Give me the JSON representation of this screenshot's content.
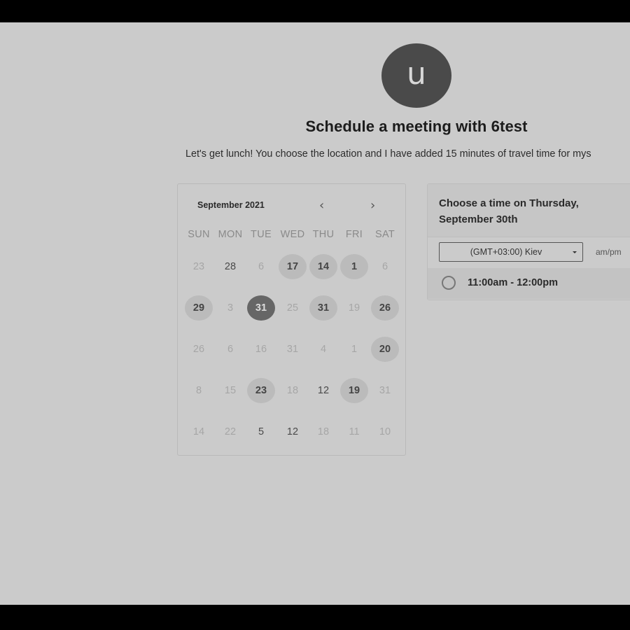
{
  "host": {
    "avatar_letter": "u",
    "title": "Schedule a meeting with 6test",
    "description": "Let's get lunch! You choose the location and I have added 15 minutes of travel time for mys"
  },
  "calendar": {
    "month_label": "September 2021",
    "prev_icon": "chevron-left-icon",
    "next_icon": "chevron-right-icon",
    "weekdays": [
      "SUN",
      "MON",
      "TUE",
      "WED",
      "THU",
      "FRI",
      "SAT"
    ],
    "weeks": [
      [
        {
          "label": "23",
          "state": "muted"
        },
        {
          "label": "28",
          "state": "dark"
        },
        {
          "label": "6",
          "state": "muted"
        },
        {
          "label": "17",
          "state": "available"
        },
        {
          "label": "14",
          "state": "available"
        },
        {
          "label": "1",
          "state": "available"
        },
        {
          "label": "6",
          "state": "muted"
        }
      ],
      [
        {
          "label": "29",
          "state": "available"
        },
        {
          "label": "3",
          "state": "muted"
        },
        {
          "label": "31",
          "state": "selected"
        },
        {
          "label": "25",
          "state": "muted"
        },
        {
          "label": "31",
          "state": "available"
        },
        {
          "label": "19",
          "state": "muted"
        },
        {
          "label": "26",
          "state": "available"
        }
      ],
      [
        {
          "label": "26",
          "state": "muted"
        },
        {
          "label": "6",
          "state": "muted"
        },
        {
          "label": "16",
          "state": "muted"
        },
        {
          "label": "31",
          "state": "muted"
        },
        {
          "label": "4",
          "state": "muted"
        },
        {
          "label": "1",
          "state": "muted"
        },
        {
          "label": "20",
          "state": "available"
        }
      ],
      [
        {
          "label": "8",
          "state": "muted"
        },
        {
          "label": "15",
          "state": "muted"
        },
        {
          "label": "23",
          "state": "available"
        },
        {
          "label": "18",
          "state": "muted"
        },
        {
          "label": "12",
          "state": "dark"
        },
        {
          "label": "19",
          "state": "available"
        },
        {
          "label": "31",
          "state": "muted"
        }
      ],
      [
        {
          "label": "14",
          "state": "muted"
        },
        {
          "label": "22",
          "state": "muted"
        },
        {
          "label": "5",
          "state": "dark"
        },
        {
          "label": "12",
          "state": "dark"
        },
        {
          "label": "18",
          "state": "muted"
        },
        {
          "label": "11",
          "state": "muted"
        },
        {
          "label": "10",
          "state": "muted"
        }
      ]
    ]
  },
  "time_panel": {
    "title": "Choose a time on Thursday, September 30th",
    "timezone": "(GMT+03:00) Kiev",
    "ampm_label": "am/pm",
    "slots": [
      "11:00am - 12:00pm"
    ]
  },
  "colors": {
    "background": "#cbcbcb",
    "avatar": "#4a4a4a",
    "selected_day": "#666666",
    "available_day": "#bbbbbb"
  }
}
